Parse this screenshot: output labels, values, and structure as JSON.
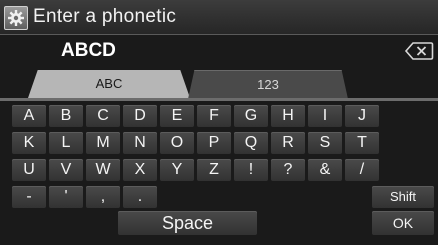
{
  "header": {
    "title": "Enter a phonetic",
    "icon": "settings-icon"
  },
  "entry": {
    "text": "ABCD",
    "backspace_icon": "backspace-icon"
  },
  "tabs": [
    {
      "label": "ABC",
      "selected": true
    },
    {
      "label": "123",
      "selected": false
    }
  ],
  "keyboard": {
    "rows": [
      [
        "A",
        "B",
        "C",
        "D",
        "E",
        "F",
        "G",
        "H",
        "I",
        "J"
      ],
      [
        "K",
        "L",
        "M",
        "N",
        "O",
        "P",
        "Q",
        "R",
        "S",
        "T"
      ],
      [
        "U",
        "V",
        "W",
        "X",
        "Y",
        "Z",
        "!",
        "?",
        "&",
        "/"
      ],
      [
        "-",
        "'",
        ",",
        "."
      ]
    ],
    "space_label": "Space",
    "shift_label": "Shift",
    "ok_label": "OK"
  },
  "colors": {
    "selected_tab": "#b6b6b6",
    "key": "#3c3c3c",
    "background": "#1a1a1a"
  }
}
